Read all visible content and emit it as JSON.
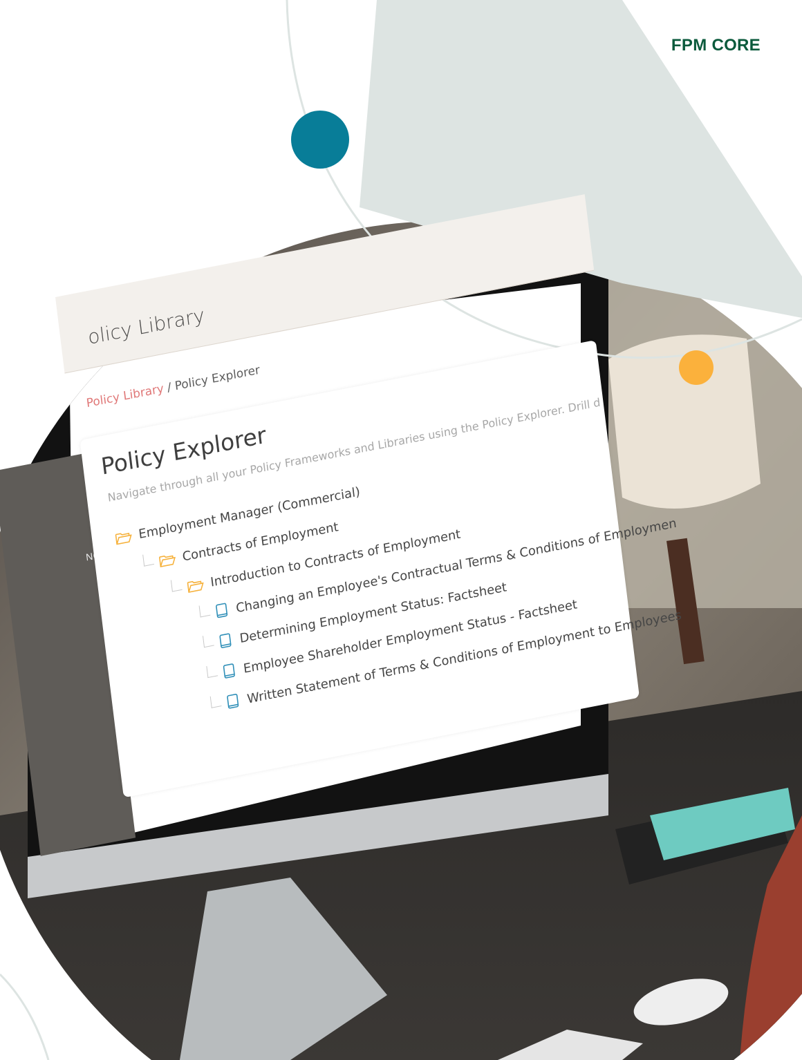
{
  "brand": {
    "name": "FPM CORE"
  },
  "colors": {
    "brand_green": "#0b5a3c",
    "teal_dot": "#087d98",
    "orange_dot": "#fbb13c",
    "pale_shape": "#dde4e2",
    "breadcrumb_link": "#e07878",
    "folder": "#f6b13b",
    "book": "#2f8fb8"
  },
  "app": {
    "header_title": "olicy Library",
    "sidebar": {
      "section_label": "NCE",
      "caret": "▾"
    },
    "breadcrumb": {
      "link": "Policy Library",
      "separator": "/",
      "current": "Policy Explorer"
    },
    "explorer": {
      "title": "Policy Explorer",
      "subtitle": "Navigate through all your Policy Frameworks and Libraries using the Policy Explorer. Drill d",
      "tree": [
        {
          "label": "Employment Manager (Commercial)",
          "icon": "folder-open-icon",
          "level": 0
        },
        {
          "label": "Contracts of Employment",
          "icon": "folder-open-icon",
          "level": 1
        },
        {
          "label": "Introduction to Contracts of Employment",
          "icon": "folder-open-icon",
          "level": 2
        },
        {
          "label": "Changing an Employee's Contractual Terms & Conditions of Employmen",
          "icon": "book-icon",
          "level": 3
        },
        {
          "label": "Determining Employment Status: Factsheet",
          "icon": "book-icon",
          "level": 3
        },
        {
          "label": "Employee Shareholder Employment Status - Factsheet",
          "icon": "book-icon",
          "level": 3
        },
        {
          "label": "Written Statement of Terms & Conditions of Employment to Employees",
          "icon": "book-icon",
          "level": 3
        }
      ]
    }
  }
}
